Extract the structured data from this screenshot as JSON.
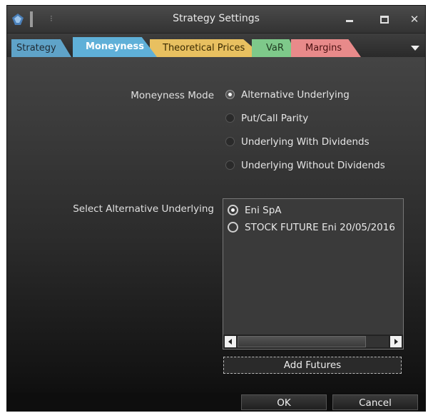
{
  "window": {
    "title": "Strategy Settings"
  },
  "tabs": [
    {
      "label": "Strategy",
      "color": "#5fa3c8"
    },
    {
      "label": "Moneyness",
      "color": "#5fb0d8",
      "active": true
    },
    {
      "label": "Theoretical Prices",
      "color": "#e8c060"
    },
    {
      "label": "VaR",
      "color": "#7ec98a"
    },
    {
      "label": "Margins",
      "color": "#e88a8a"
    }
  ],
  "moneyness": {
    "mode_label": "Moneyness Mode",
    "options": [
      {
        "label": "Alternative Underlying",
        "selected": true
      },
      {
        "label": "Put/Call Parity",
        "selected": false
      },
      {
        "label": "Underlying With Dividends",
        "selected": false
      },
      {
        "label": "Underlying Without Dividends",
        "selected": false
      }
    ],
    "alt_label": "Select Alternative Underlying",
    "underlyings": [
      {
        "label": "Eni SpA",
        "selected": true
      },
      {
        "label": "STOCK FUTURE Eni 20/05/2016",
        "selected": false
      }
    ],
    "add_futures_label": "Add Futures"
  },
  "buttons": {
    "ok": "OK",
    "cancel": "Cancel"
  },
  "icons": {
    "app": "app-logo-icon",
    "pin": "pin-icon",
    "minimize": "minimize-icon",
    "maximize": "maximize-icon",
    "close": "close-icon",
    "tab_overflow": "chevron-down-icon"
  }
}
